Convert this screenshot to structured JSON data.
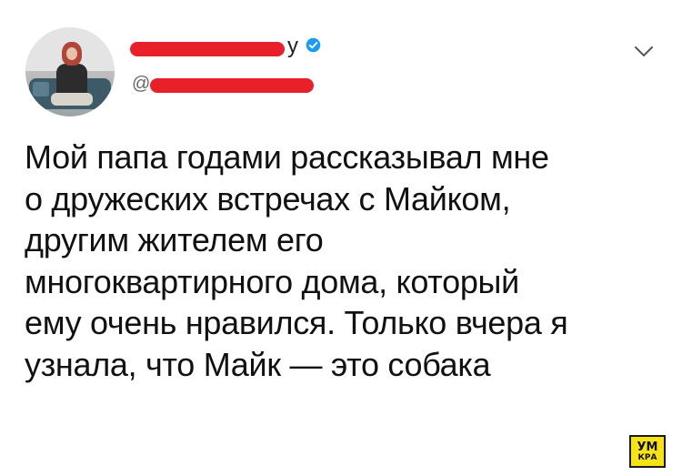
{
  "header": {
    "name_visible_suffix": "y",
    "handle_visible_prefix": "@",
    "colors": {
      "redaction": "#e8202a",
      "verified": "#1d9bf0"
    },
    "icons": {
      "verified": "verified-badge-icon",
      "menu": "chevron-down-icon"
    }
  },
  "tweet": {
    "lines": [
      "Мой папа годами рассказывал мне",
      "о дружеских встречах с Майком,",
      "другим жителем его",
      "многоквартирного дома, который",
      "ему очень нравился. Только вчера я",
      "узнала, что Майк — это собака"
    ]
  },
  "watermark": {
    "line1": "УМ",
    "line2": "КРА",
    "color": "#f7e21a"
  }
}
